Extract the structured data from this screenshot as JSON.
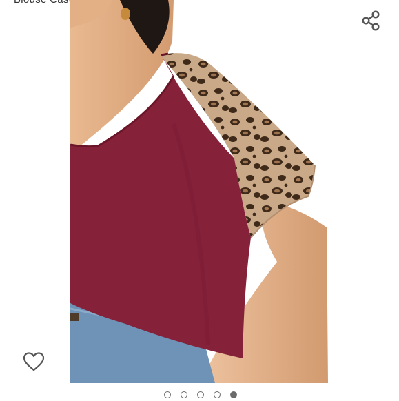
{
  "product": {
    "title_fragment": "Blouse Casual Loose Shirt Tops",
    "image_alt": "Burgundy V-neck top with leopard print raglan sleeves"
  },
  "actions": {
    "share_icon": "share-icon",
    "favorite_icon": "heart-outline-icon"
  },
  "carousel": {
    "total": 5,
    "active_index": 4
  },
  "colors": {
    "top": "#86213a",
    "leopard_base": "#c9a988",
    "leopard_spot": "#3f2a1a",
    "icon": "#555555",
    "dot": "#6b6b6b"
  }
}
